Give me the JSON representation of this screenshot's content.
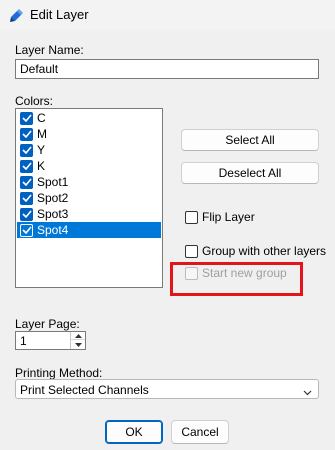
{
  "window": {
    "title": "Edit Layer",
    "app_icon": "pen-layer-icon"
  },
  "layer_name": {
    "label": "Layer Name:",
    "value": "Default"
  },
  "colors": {
    "label": "Colors:",
    "items": [
      {
        "label": "C",
        "checked": true
      },
      {
        "label": "M",
        "checked": true
      },
      {
        "label": "Y",
        "checked": true
      },
      {
        "label": "K",
        "checked": true
      },
      {
        "label": "Spot1",
        "checked": true
      },
      {
        "label": "Spot2",
        "checked": true
      },
      {
        "label": "Spot3",
        "checked": true
      },
      {
        "label": "Spot4",
        "checked": true,
        "selected": true
      }
    ]
  },
  "buttons": {
    "select_all": "Select All",
    "deselect_all": "Deselect All",
    "ok": "OK",
    "cancel": "Cancel"
  },
  "options": {
    "flip_layer": {
      "label": "Flip Layer",
      "checked": false
    },
    "group_with_other": {
      "label": "Group with other layers",
      "checked": false
    },
    "start_new_group": {
      "label": "Start new group",
      "checked": false,
      "enabled": false
    }
  },
  "layer_page": {
    "label": "Layer Page:",
    "value": "1"
  },
  "printing_method": {
    "label": "Printing Method:",
    "value": "Print Selected Channels"
  },
  "colors_palette": {
    "accent": "#0078d7",
    "highlight": "#e3151a"
  }
}
